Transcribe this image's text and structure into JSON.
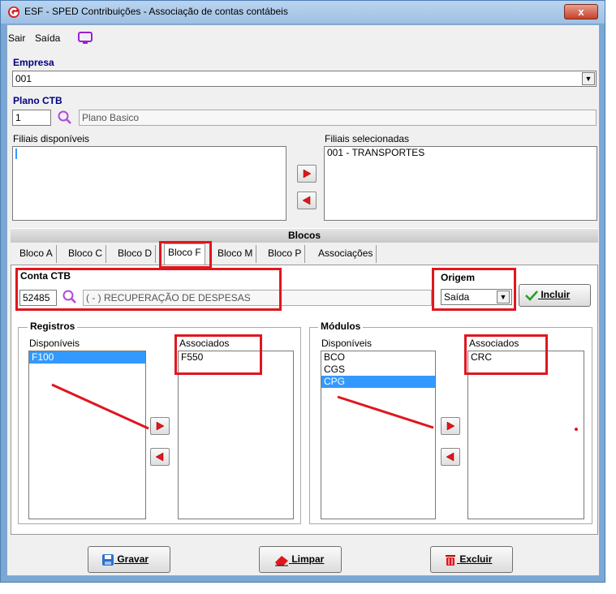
{
  "window": {
    "title": "ESF - SPED Contribuições - Associação de contas contábeis",
    "close_label": "x"
  },
  "menu": {
    "items": [
      "Sair",
      "Saída"
    ]
  },
  "empresa": {
    "label": "Empresa",
    "value": "001 "
  },
  "plano": {
    "label": "Plano CTB",
    "code": "1",
    "description": "Plano Basico"
  },
  "filiais": {
    "disponiveis_label": "Filiais disponíveis",
    "selecionadas_label": "Filiais selecionadas",
    "selecionadas": [
      "001 - TRANSPORTES"
    ]
  },
  "blocos": {
    "header": "Blocos",
    "tabs": [
      "Bloco A",
      "Bloco C",
      "Bloco D",
      "Bloco F",
      "Bloco M",
      "Bloco P",
      "Associações"
    ],
    "active_tab": "Bloco F"
  },
  "conta": {
    "label": "Conta CTB",
    "code": "52485",
    "description": "( - ) RECUPERAÇÃO DE DESPESAS"
  },
  "origem": {
    "label": "Origem",
    "value": "Saída"
  },
  "incluir_label": "Incluir",
  "registros": {
    "title": "Registros",
    "disponiveis_label": "Disponíveis",
    "associados_label": "Associados",
    "disponiveis": [
      "F100"
    ],
    "associados": [
      "F550"
    ],
    "selected": "F100"
  },
  "modulos": {
    "title": "Módulos",
    "disponiveis_label": "Disponíveis",
    "associados_label": "Associados",
    "disponiveis": [
      "BCO",
      "CGS",
      "CPG"
    ],
    "associados": [
      "CRC"
    ],
    "selected": "CPG"
  },
  "buttons": {
    "gravar": "Gravar",
    "limpar": "Limpar",
    "excluir": "Excluir"
  },
  "colors": {
    "highlight": "#e0161e",
    "selection": "#3399ff",
    "label_blue": "#000080"
  }
}
